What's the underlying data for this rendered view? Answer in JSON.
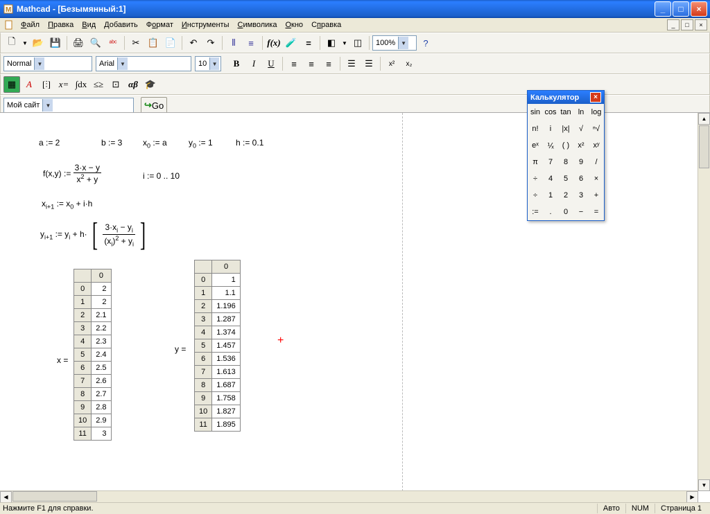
{
  "titlebar": {
    "title": "Mathcad - [Безымянный:1]"
  },
  "menu": {
    "file": "Файл",
    "edit": "Правка",
    "view": "Вид",
    "insert": "Добавить",
    "format": "Формат",
    "tools": "Инструменты",
    "symbolics": "Символика",
    "window": "Окно",
    "help": "Справка"
  },
  "toolbar2": {
    "style": "Normal",
    "font": "Arial",
    "size": "10",
    "zoom": "100%"
  },
  "toolbar4": {
    "site": "Мой сайт",
    "go": "Go"
  },
  "palette": {
    "title": "Калькулятор",
    "rows": [
      [
        "sin",
        "cos",
        "tan",
        "ln",
        "log"
      ],
      [
        "n!",
        "i",
        "|x|",
        "√",
        "ⁿ√"
      ],
      [
        "eˣ",
        "⅟ₓ",
        "( )",
        "x²",
        "xʸ"
      ],
      [
        "π",
        "7",
        "8",
        "9",
        "/"
      ],
      [
        "÷",
        "4",
        "5",
        "6",
        "×"
      ],
      [
        "÷",
        "1",
        "2",
        "3",
        "+"
      ],
      [
        ":=",
        ".",
        "0",
        "−",
        "="
      ]
    ]
  },
  "equations": {
    "a": "a := 2",
    "b": "b := 3",
    "x0": "x",
    "x0sub": "0",
    "x0eq": " := a",
    "y0": "y",
    "y0sub": "0",
    "y0eq": " := 1",
    "h": "h := 0.1",
    "fdef_l": "f(x,y) := ",
    "f_num": "3·x − y",
    "f_den": "x² + y",
    "i": "i := 0 .. 10",
    "xrec_l": "x",
    "xrec_sub": "i+1",
    "xrec": " := x",
    "xrec_sub2": "0",
    "xrec_r": " + i·h",
    "yrec_l": "y",
    "yrec_sub": "i+1",
    "yrec_m": " := y",
    "yrec_sub2": "i",
    "yrec_r": " + h·",
    "yrec_num": "3·xᵢ − yᵢ",
    "yrec_den": "(xᵢ)² + yᵢ"
  },
  "xtable": {
    "label": "x =",
    "head": "0",
    "rows": [
      [
        "0",
        "2"
      ],
      [
        "1",
        "2"
      ],
      [
        "2",
        "2.1"
      ],
      [
        "3",
        "2.2"
      ],
      [
        "4",
        "2.3"
      ],
      [
        "5",
        "2.4"
      ],
      [
        "6",
        "2.5"
      ],
      [
        "7",
        "2.6"
      ],
      [
        "8",
        "2.7"
      ],
      [
        "9",
        "2.8"
      ],
      [
        "10",
        "2.9"
      ],
      [
        "11",
        "3"
      ]
    ]
  },
  "ytable": {
    "label": "y =",
    "head": "0",
    "rows": [
      [
        "0",
        "1"
      ],
      [
        "1",
        "1.1"
      ],
      [
        "2",
        "1.196"
      ],
      [
        "3",
        "1.287"
      ],
      [
        "4",
        "1.374"
      ],
      [
        "5",
        "1.457"
      ],
      [
        "6",
        "1.536"
      ],
      [
        "7",
        "1.613"
      ],
      [
        "8",
        "1.687"
      ],
      [
        "9",
        "1.758"
      ],
      [
        "10",
        "1.827"
      ],
      [
        "11",
        "1.895"
      ]
    ]
  },
  "status": {
    "hint": "Нажмите F1 для справки.",
    "auto": "Авто",
    "num": "NUM",
    "page": "Страница 1"
  }
}
